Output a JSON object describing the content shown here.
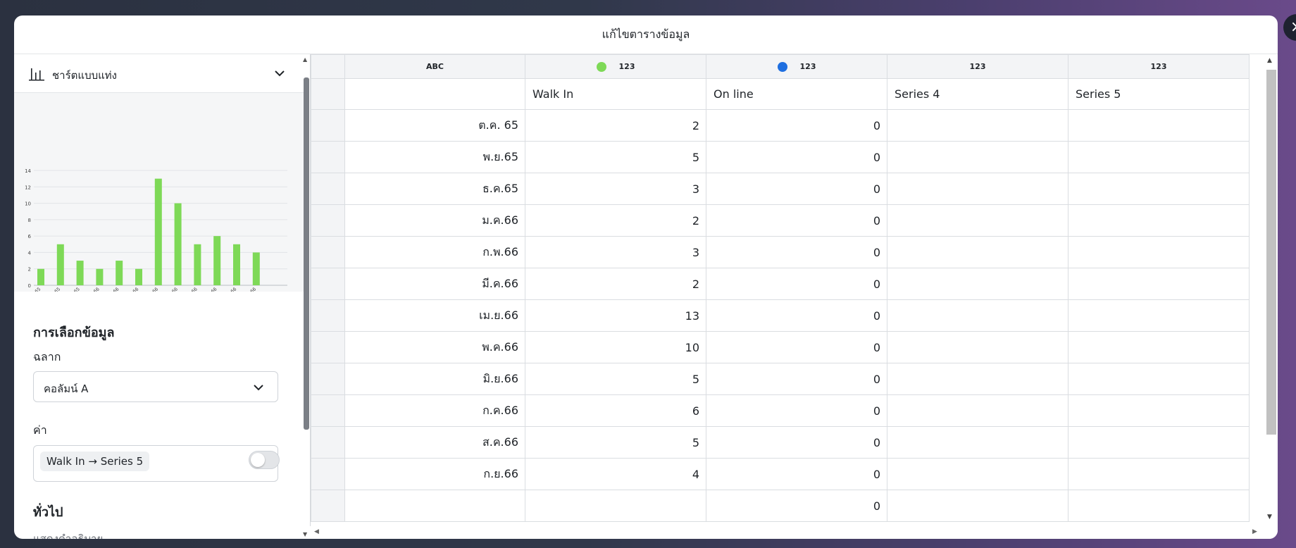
{
  "dialog": {
    "title": "แก้ไขตารางข้อมูล",
    "close_icon": "close-icon"
  },
  "left_panel": {
    "chart_type_label": "ชาร์ตแบบแท่ง",
    "data_selection_title": "การเลือกข้อมูล",
    "label_field": {
      "label": "ฉลาก",
      "value": "คอลัมน์ A"
    },
    "value_field": {
      "label": "ค่า",
      "chip": "Walk In → Series 5"
    },
    "general_title": "ทั่วไป",
    "show_legend_label": "แสดงคำอธิบาย",
    "show_legend_on": false
  },
  "chart_data": {
    "type": "bar",
    "categories": [
      "ต.ค. 65",
      "พ.ย.65",
      "ธ.ค.65",
      "ม.ค.66",
      "ก.พ.66",
      "มี.ค.66",
      "เม.ย.66",
      "พ.ค.66",
      "มิ.ย.66",
      "ก.ค.66",
      "ส.ค.66",
      "ก.ย.66"
    ],
    "values": [
      2,
      5,
      3,
      2,
      3,
      2,
      13,
      10,
      5,
      6,
      5,
      4
    ],
    "ylim": [
      0,
      14
    ],
    "yticks": [
      "0",
      "2",
      "4",
      "6",
      "8",
      "10",
      "12",
      "14"
    ],
    "color": "#7ed957",
    "grid": true
  },
  "grid": {
    "type_row": [
      "ABC",
      "123",
      "123",
      "123",
      "123"
    ],
    "series_colors": [
      "#7ed957",
      "#1f6fe0"
    ],
    "headers": [
      "",
      "Walk In",
      "On line",
      "Series 4",
      "Series 5"
    ],
    "rows": [
      [
        "ต.ค. 65",
        "2",
        "0",
        "",
        ""
      ],
      [
        "พ.ย.65",
        "5",
        "0",
        "",
        ""
      ],
      [
        "ธ.ค.65",
        "3",
        "0",
        "",
        ""
      ],
      [
        "ม.ค.66",
        "2",
        "0",
        "",
        ""
      ],
      [
        "ก.พ.66",
        "3",
        "0",
        "",
        ""
      ],
      [
        "มี.ค.66",
        "2",
        "0",
        "",
        ""
      ],
      [
        "เม.ย.66",
        "13",
        "0",
        "",
        ""
      ],
      [
        "พ.ค.66",
        "10",
        "0",
        "",
        ""
      ],
      [
        "มิ.ย.66",
        "5",
        "0",
        "",
        ""
      ],
      [
        "ก.ค.66",
        "6",
        "0",
        "",
        ""
      ],
      [
        "ส.ค.66",
        "5",
        "0",
        "",
        ""
      ],
      [
        "ก.ย.66",
        "4",
        "0",
        "",
        ""
      ],
      [
        "",
        "",
        "0",
        "",
        ""
      ]
    ]
  }
}
